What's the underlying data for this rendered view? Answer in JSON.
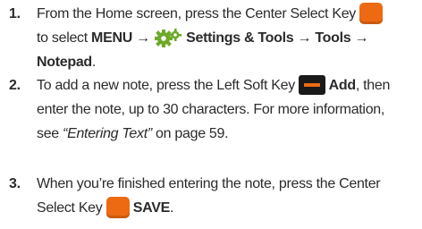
{
  "steps": [
    {
      "number": "1.",
      "line1": {
        "text": "From the Home screen, press the Center Select Key",
        "icon": "center-select-key-icon"
      },
      "line2": {
        "prefix": "to select ",
        "menu": "MENU",
        "arrow1": " → ",
        "icon": "settings-gear-icon",
        "settings": " Settings & Tools",
        "arrow2": " → ",
        "tools": "Tools",
        "arrow3": " →"
      },
      "line3": {
        "notepad": "Notepad",
        "suffix": "."
      }
    },
    {
      "number": "2.",
      "line1": {
        "text": "To add a new note, press the Left Soft Key ",
        "icon": "left-soft-key-icon",
        "add": " Add",
        "suffix": ", then"
      },
      "line2": {
        "text": "enter the note, up to 30 characters. For more information,"
      },
      "line3": {
        "prefix": "see ",
        "link": "“Entering Text”",
        "suffix": " on page 59."
      }
    },
    {
      "number": "3.",
      "line1": {
        "text": "When you’re finished entering the note, press the Center"
      },
      "line2": {
        "text": "Select Key ",
        "icon": "center-select-key-icon",
        "save": " SAVE",
        "suffix": "."
      }
    }
  ],
  "colors": {
    "text": "#2b2b2b",
    "key_orange": "#ee6a12",
    "soft_key_black": "#1a1a1a",
    "gear_green": "#6ea92a"
  }
}
